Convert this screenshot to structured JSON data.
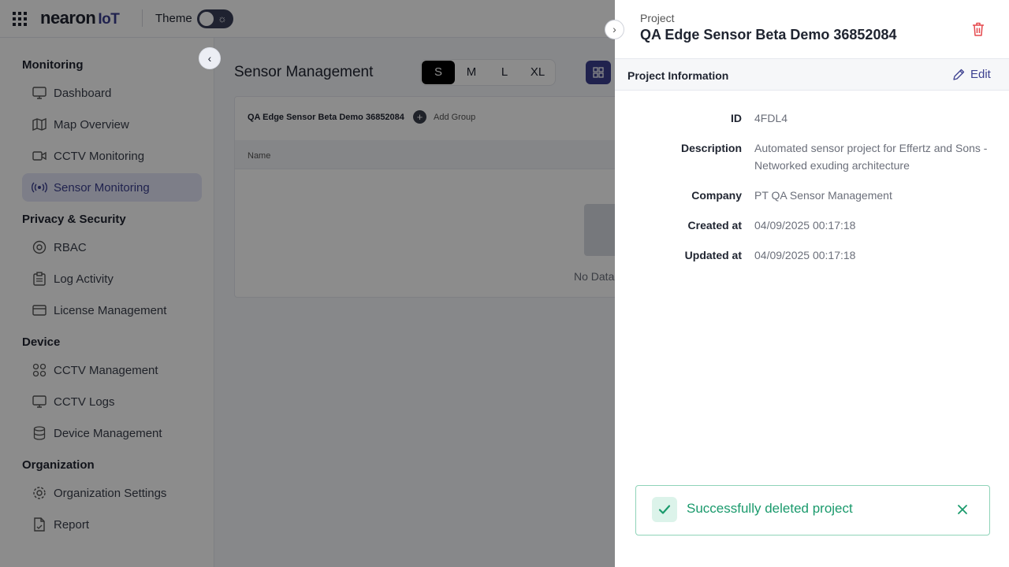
{
  "topbar": {
    "logo_main": "nearon",
    "logo_suffix": "IoT",
    "theme_label": "Theme"
  },
  "sidebar": {
    "sections": [
      {
        "title": "Monitoring"
      },
      {
        "title": "Privacy & Security"
      },
      {
        "title": "Device"
      },
      {
        "title": "Organization"
      }
    ],
    "items": [
      {
        "label": "Dashboard",
        "icon": "monitor-icon"
      },
      {
        "label": "Map Overview",
        "icon": "map-icon"
      },
      {
        "label": "CCTV Monitoring",
        "icon": "video-icon"
      },
      {
        "label": "Sensor Monitoring",
        "icon": "broadcast-icon",
        "active": true
      },
      {
        "label": "RBAC",
        "icon": "at-sign-icon"
      },
      {
        "label": "Log Activity",
        "icon": "clipboard-icon"
      },
      {
        "label": "License Management",
        "icon": "credit-card-icon"
      },
      {
        "label": "CCTV Management",
        "icon": "grid-icon"
      },
      {
        "label": "CCTV Logs",
        "icon": "monitor-icon"
      },
      {
        "label": "Device Management",
        "icon": "database-icon"
      },
      {
        "label": "Organization Settings",
        "icon": "gear-icon"
      },
      {
        "label": "Report",
        "icon": "file-icon"
      }
    ]
  },
  "main": {
    "title": "Sensor Management",
    "sizes": [
      "S",
      "M",
      "L",
      "XL"
    ],
    "selected_size": "S",
    "card": {
      "project_name": "QA Edge Sensor Beta Demo 36852084",
      "add_group_label": "Add Group",
      "column_name": "Name",
      "empty_text": "No Data"
    }
  },
  "drawer": {
    "kicker": "Project",
    "title": "QA Edge Sensor Beta Demo 36852084",
    "info_title": "Project Information",
    "edit_label": "Edit",
    "fields": [
      {
        "label": "ID",
        "value": "4FDL4"
      },
      {
        "label": "Description",
        "value": "Automated sensor project for Effertz and Sons - Networked exuding architecture"
      },
      {
        "label": "Company",
        "value": "PT QA Sensor Management"
      },
      {
        "label": "Created at",
        "value": "04/09/2025 00:17:18"
      },
      {
        "label": "Updated at",
        "value": "04/09/2025 00:17:18"
      }
    ]
  },
  "toast": {
    "message": "Successfully deleted project",
    "status_color": "#1a9a6c"
  },
  "colors": {
    "accent": "#3b3f8f",
    "danger": "#e5484d",
    "success": "#1a9a6c"
  }
}
